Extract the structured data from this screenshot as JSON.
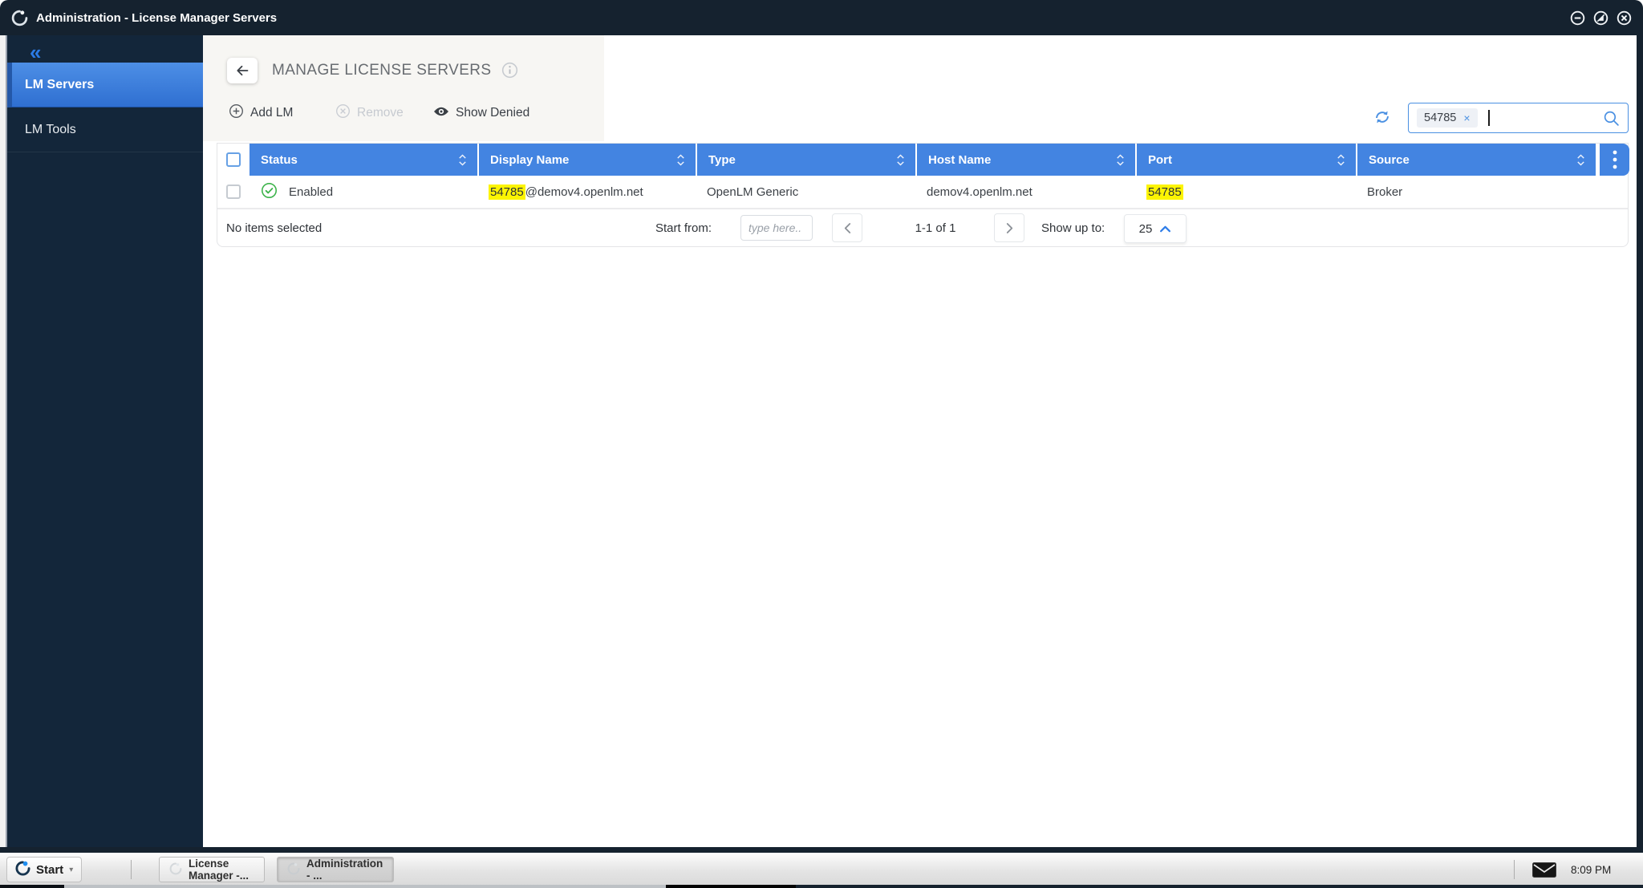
{
  "window": {
    "title": "Administration - License Manager Servers"
  },
  "sidebar": {
    "collapse_icon": "«",
    "items": [
      {
        "label": "LM Servers"
      },
      {
        "label": "LM Tools"
      }
    ]
  },
  "page": {
    "title": "MANAGE LICENSE SERVERS",
    "toolbar": {
      "add_label": "Add LM",
      "remove_label": "Remove",
      "show_denied_label": "Show Denied"
    },
    "search": {
      "chip_value": "54785",
      "chip_remove": "×",
      "value": ""
    }
  },
  "table": {
    "columns": [
      "Status",
      "Display Name",
      "Type",
      "Host Name",
      "Port",
      "Source"
    ],
    "rows": [
      {
        "status": "Enabled",
        "display_name_highlight": "54785",
        "display_name_rest": "@demov4.openlm.net",
        "type": "OpenLM Generic",
        "host_name": "demov4.openlm.net",
        "port": "54785",
        "source": "Broker"
      }
    ]
  },
  "footer": {
    "selection_text": "No items selected",
    "start_from_label": "Start from:",
    "start_from_placeholder": "type here..",
    "page_range": "1-1 of 1",
    "show_up_to_label": "Show up to:",
    "page_size": "25"
  },
  "taskbar": {
    "start_label": "Start",
    "start_caret": "▾",
    "buttons": [
      {
        "label": "License Manager -..."
      },
      {
        "label": "Administration - ..."
      }
    ],
    "clock": "8:09 PM"
  },
  "colors": {
    "titlebar_bg": "#15222f",
    "sidebar_bg": "#13263a",
    "selected_item_blue": "#3f7fdb",
    "table_header_blue": "#4384e1",
    "accent_blue": "#4a90e2",
    "highlight_yellow": "#fcf403",
    "status_green": "#3cb34a"
  }
}
